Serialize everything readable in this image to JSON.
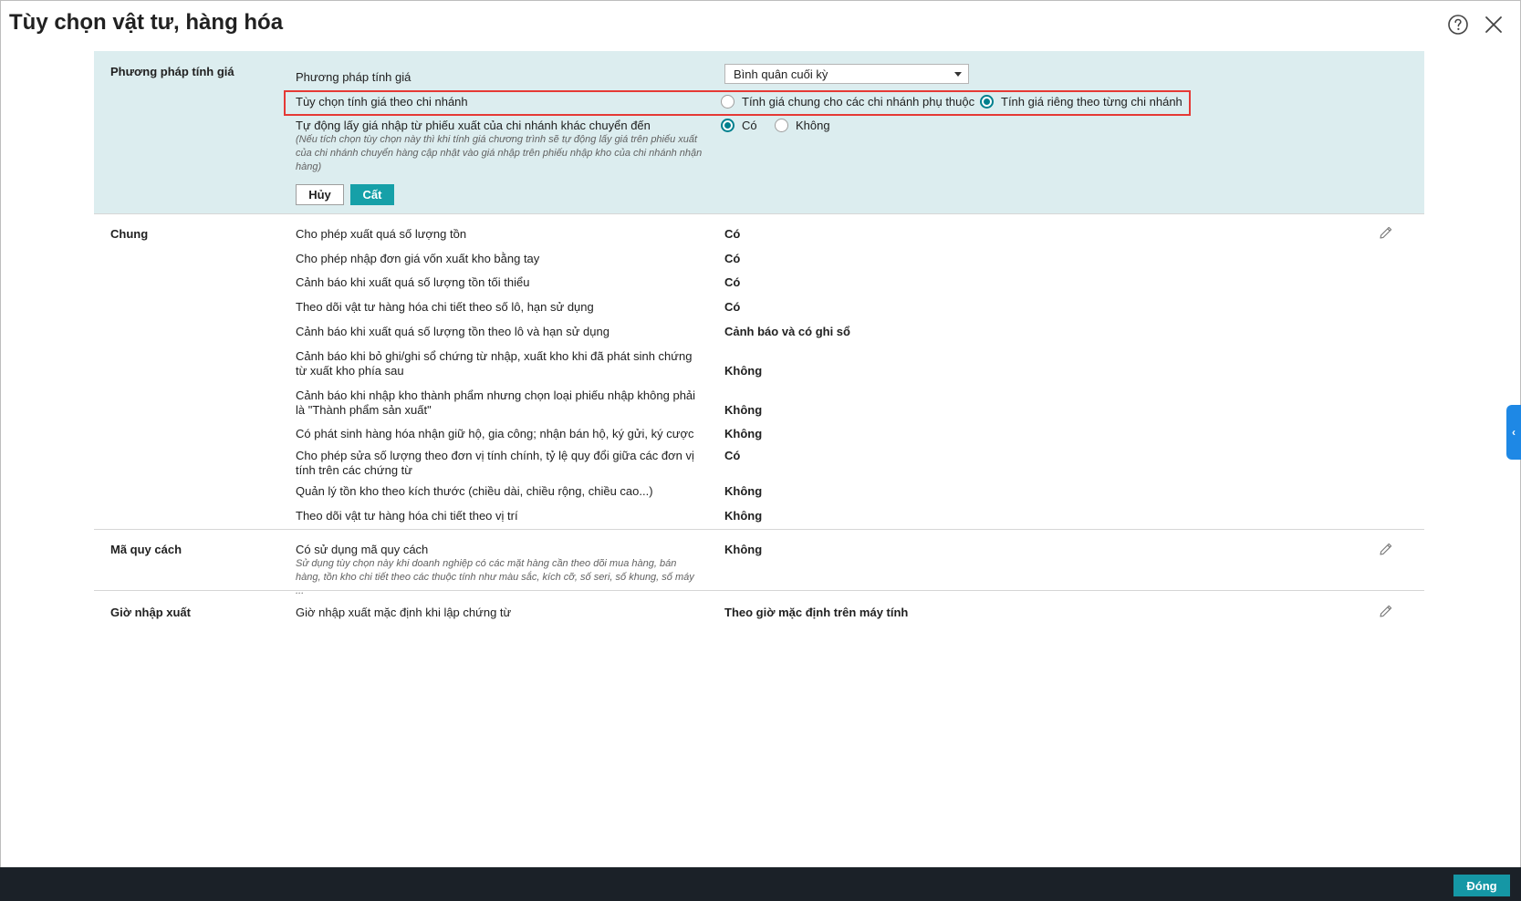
{
  "window": {
    "title": "Tùy chọn vật tư, hàng hóa",
    "help_icon": "help-circle-icon",
    "close_icon": "close-icon"
  },
  "price_section": {
    "title": "Phương pháp tính giá",
    "method_label": "Phương pháp tính giá",
    "method_value": "Bình quân cuối kỳ",
    "branch_label": "Tùy chọn tính giá theo chi nhánh",
    "branch_option_common": "Tính giá chung cho các chi nhánh phụ thuộc",
    "branch_option_separate": "Tính giá riêng theo từng chi nhánh",
    "branch_selected": "Tính giá riêng theo từng chi nhánh",
    "auto_label": "Tự động lấy giá nhập từ phiếu xuất của chi nhánh khác chuyển đến",
    "auto_note": "(Nếu tích chọn tùy chọn này thì khi tính giá chương trình sẽ tự động lấy giá trên phiếu xuất của chi nhánh chuyển hàng cập nhật vào giá nhập trên phiếu nhập kho của chi nhánh nhận hàng)",
    "auto_option_yes": "Có",
    "auto_option_no": "Không",
    "auto_selected": "Có",
    "cancel_button": "Hủy",
    "save_button": "Cất",
    "highlight_color": "#e53935",
    "background_color": "#dcedef"
  },
  "general_section": {
    "title": "Chung",
    "edit_icon": "pencil-icon",
    "rows": [
      {
        "label": "Cho phép xuất quá số lượng tồn",
        "value": "Có"
      },
      {
        "label": "Cho phép nhập đơn giá vốn xuất kho bằng tay",
        "value": "Có"
      },
      {
        "label": "Cảnh báo khi xuất quá số lượng tồn tối thiểu",
        "value": "Có"
      },
      {
        "label": "Theo dõi vật tư hàng hóa chi tiết theo số lô, hạn sử dụng",
        "value": "Có"
      },
      {
        "label": "Cảnh báo khi xuất quá số lượng tồn theo lô và hạn sử dụng",
        "value": "Cảnh báo và có ghi sổ"
      },
      {
        "label": "Cảnh báo khi bỏ ghi/ghi sổ chứng từ nhập, xuất kho khi đã phát sinh chứng từ xuất kho phía sau",
        "value": "Không"
      },
      {
        "label": "Cảnh báo khi nhập kho thành phẩm nhưng chọn loại phiếu nhập không phải là \"Thành phẩm sản xuất\"",
        "value": "Không"
      },
      {
        "label": "Có phát sinh hàng hóa nhận giữ hộ, gia công; nhận bán hộ, ký gửi, ký cược",
        "value": "Không"
      },
      {
        "label": "Cho phép sửa số lượng theo đơn vị tính chính, tỷ lệ quy đổi giữa các đơn vị tính trên các chứng từ",
        "value": "Có"
      },
      {
        "label": "Quản lý tồn kho theo kích thước (chiều dài, chiều rộng, chiều cao...)",
        "value": "Không"
      },
      {
        "label": "Theo dõi vật tư hàng hóa chi tiết theo vị trí",
        "value": "Không"
      }
    ]
  },
  "spec_section": {
    "title": "Mã quy cách",
    "label": "Có sử dụng mã quy cách",
    "note": "Sử dụng tùy chọn này khi doanh nghiệp có các mặt hàng cần theo dõi mua hàng, bán hàng, tồn kho chi tiết theo các thuộc tính như màu sắc, kích cỡ, số seri, số khung, số máy ...",
    "value": "Không"
  },
  "time_section": {
    "title": "Giờ nhập xuất",
    "label": "Giờ nhập xuất mặc định khi lập chứng từ",
    "value": "Theo giờ mặc định trên máy tính"
  },
  "side_tab": {
    "glyph": "‹",
    "color": "#1e88e5"
  },
  "footer": {
    "close_button": "Đóng",
    "accent": "#1597a5"
  }
}
